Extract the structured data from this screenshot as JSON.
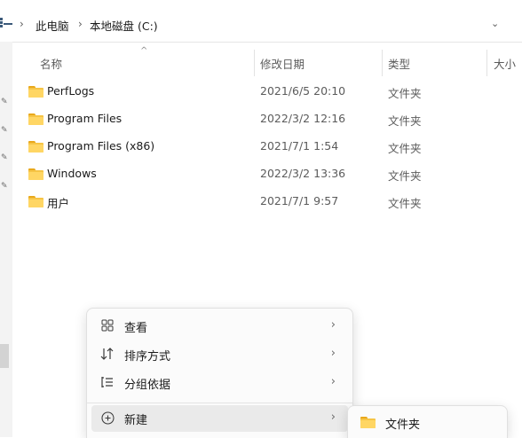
{
  "address_bar": {
    "crumbs": [
      "此电脑",
      "本地磁盘 (C:)"
    ],
    "separator": "›",
    "dropdown": "⌄"
  },
  "columns": {
    "name": "名称",
    "date": "修改日期",
    "type": "类型",
    "size": "大小",
    "sort_indicator": "^"
  },
  "files": [
    {
      "name": "PerfLogs",
      "date": "2021/6/5 20:10",
      "type": "文件夹",
      "icon": "folder-icon"
    },
    {
      "name": "Program Files",
      "date": "2022/3/2 12:16",
      "type": "文件夹",
      "icon": "folder-icon"
    },
    {
      "name": "Program Files (x86)",
      "date": "2021/7/1 1:54",
      "type": "文件夹",
      "icon": "folder-icon"
    },
    {
      "name": "Windows",
      "date": "2022/3/2 13:36",
      "type": "文件夹",
      "icon": "folder-icon"
    },
    {
      "name": "用户",
      "date": "2021/7/1 9:57",
      "type": "文件夹",
      "icon": "folder-icon"
    }
  ],
  "context_menu": {
    "items": [
      {
        "label": "查看",
        "icon": "grid-view-icon",
        "arrow": "›"
      },
      {
        "label": "排序方式",
        "icon": "sort-icon",
        "arrow": "›"
      },
      {
        "label": "分组依据",
        "icon": "group-list-icon",
        "arrow": "›"
      },
      {
        "label": "新建",
        "icon": "add-circle-icon",
        "arrow": "›"
      }
    ],
    "highlighted": "新建"
  },
  "submenu": {
    "items": [
      {
        "label": "文件夹",
        "icon": "folder-icon"
      }
    ]
  },
  "colors": {
    "folder": "#f6c445",
    "menu_bg": "#fbfbfb",
    "hover": "#eaeaea"
  }
}
